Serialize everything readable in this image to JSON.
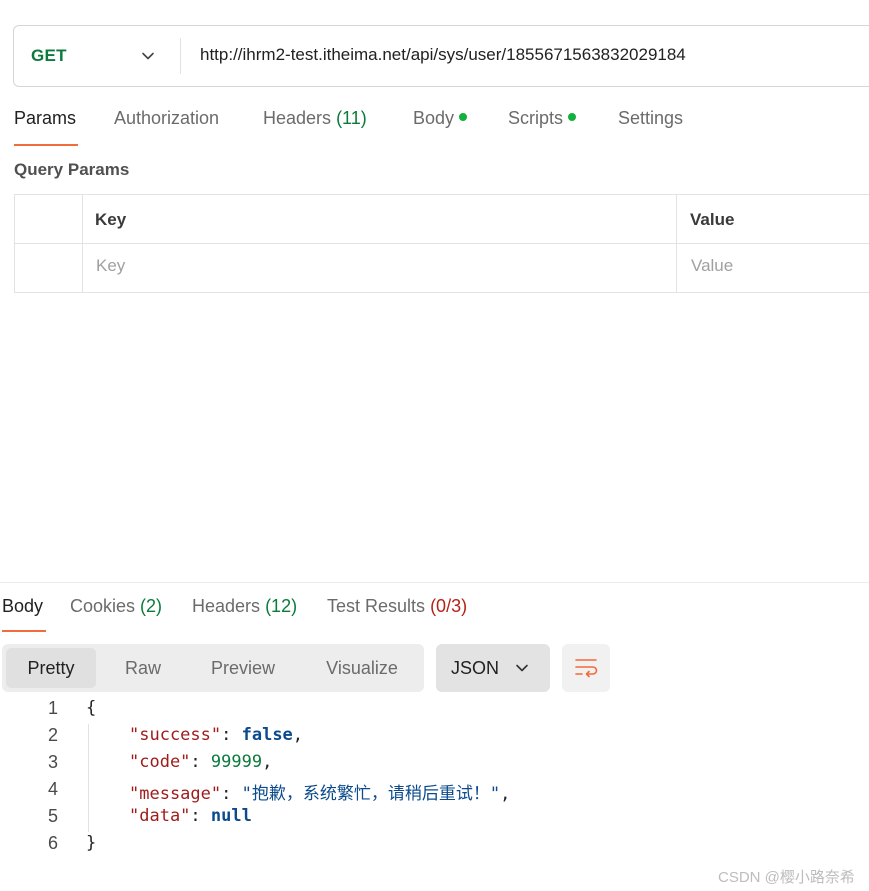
{
  "request": {
    "method": "GET",
    "url": "http://ihrm2-test.itheima.net/api/sys/user/1855671563832029184"
  },
  "request_tabs": {
    "params": "Params",
    "authorization": "Authorization",
    "headers": "Headers",
    "headers_count": "(11)",
    "body": "Body",
    "scripts": "Scripts",
    "settings": "Settings"
  },
  "query_params": {
    "title": "Query Params",
    "columns": {
      "key": "Key",
      "value": "Value"
    },
    "placeholders": {
      "key": "Key",
      "value": "Value"
    }
  },
  "response_tabs": {
    "body": "Body",
    "cookies": "Cookies",
    "cookies_count": "(2)",
    "headers": "Headers",
    "headers_count": "(12)",
    "tests": "Test Results",
    "tests_count": "(0/3)"
  },
  "view_modes": {
    "pretty": "Pretty",
    "raw": "Raw",
    "preview": "Preview",
    "visualize": "Visualize",
    "selected": "Pretty"
  },
  "format": {
    "selected": "JSON"
  },
  "code": {
    "line_numbers": [
      "1",
      "2",
      "3",
      "4",
      "5",
      "6"
    ],
    "open_brace": "{",
    "close_brace": "}",
    "success_key": "\"success\"",
    "success_value": "false",
    "code_key": "\"code\"",
    "code_value": "99999",
    "message_key": "\"message\"",
    "message_value": "\"抱歉，系统繁忙，请稍后重试！\"",
    "data_key": "\"data\"",
    "data_value": "null",
    "colon": ": ",
    "comma": ","
  },
  "watermark": "CSDN @樱小路奈希",
  "colors": {
    "accent": "#f26b3a",
    "method_get": "#0b7a3b",
    "status_dot": "#12b03c"
  }
}
